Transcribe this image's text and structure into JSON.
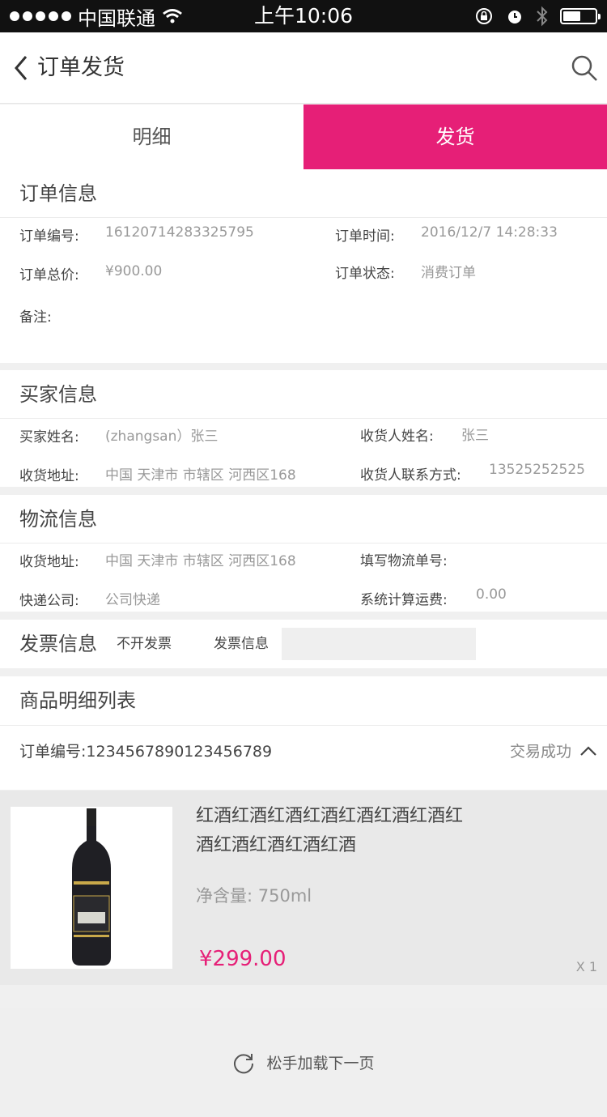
{
  "status_bar": {
    "carrier": "中国联通",
    "time": "上午10:06"
  },
  "navbar": {
    "title": "订单发货"
  },
  "tabs": [
    {
      "label": "明细"
    },
    {
      "label": "发货"
    }
  ],
  "order_info": {
    "title": "订单信息",
    "order_no_label": "订单编号:",
    "order_no": "16120714283325795",
    "order_time_label": "订单时间:",
    "order_time": "2016/12/7 14:28:33",
    "total_label": "订单总价:",
    "total": "¥900.00",
    "status_label": "订单状态:",
    "status": "消费订单",
    "remark_label": "备注:"
  },
  "buyer_info": {
    "title": "买家信息",
    "buyer_name_label": "买家姓名:",
    "buyer_name": "(zhangsan）张三",
    "receiver_label": "收货人姓名:",
    "receiver": "张三",
    "address_label": "收货地址:",
    "address": "中国 天津市 市辖区 河西区168",
    "contact_label": "收货人联系方式:",
    "contact": "13525252525"
  },
  "logistics_info": {
    "title": "物流信息",
    "address_label": "收货地址:",
    "address": "中国 天津市 市辖区 河西区168",
    "tracking_label": "填写物流单号:",
    "courier_label": "快递公司:",
    "courier": "公司快递",
    "freight_label": "系统计算运费:",
    "freight": "0.00"
  },
  "invoice": {
    "title": "发票信息",
    "option": "不开发票",
    "info_label": "发票信息",
    "info_value": ""
  },
  "goods": {
    "title": "商品明细列表",
    "order_no_label": "订单编号:1234567890123456789",
    "trade_status": "交易成功",
    "item": {
      "name_line1": "红酒红酒红酒红酒红酒红酒红酒红",
      "name_line2": "酒红酒红酒红酒红酒",
      "volume": "净含量:  750ml",
      "price": "¥299.00",
      "qty": "X 1"
    }
  },
  "load_more": {
    "label": "松手加载下一页"
  },
  "colors": {
    "accent": "#e61f77"
  }
}
